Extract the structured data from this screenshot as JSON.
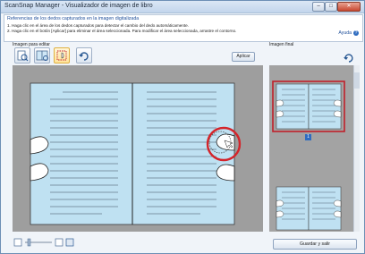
{
  "window": {
    "title": "ScanSnap Manager - Visualizador de imagen de libro"
  },
  "controls": {
    "minimize": "–",
    "maximize": "□",
    "close": "✕"
  },
  "instructions": {
    "heading": "Referencias de los dedos capturados en la imagen digitalizada",
    "line1": "1. Haga clic en el área de los dedos capturados para detectar el cambio del dedo automáticamente.",
    "line2": "2. Haga clic en el botón [Aplicar] para eliminar el área seleccionada. Para modificar el área seleccionada, arrastre el contorno.",
    "help": "Ayuda",
    "help_icon": "?"
  },
  "labels": {
    "edit": "Imagen para editar",
    "final": "Imagen final"
  },
  "toolbar": {
    "apply": "Aplicar",
    "tools": [
      {
        "name": "fit-page-icon"
      },
      {
        "name": "open-book-icon"
      },
      {
        "name": "finger-select-icon"
      },
      {
        "name": "undo-icon"
      }
    ]
  },
  "thumbnails": {
    "page_badge": "1"
  },
  "footer": {
    "save": "Guardar y salir"
  },
  "colors": {
    "page": "#bfe1f2",
    "highlight": "#d4242a",
    "frame": "#c0202b"
  }
}
